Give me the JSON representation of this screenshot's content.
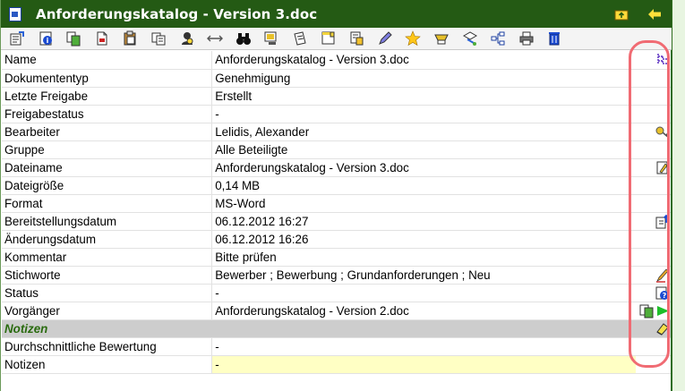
{
  "window": {
    "title": "Anforderungskatalog - Version 3.doc",
    "title_icon": "word-doc-icon",
    "buttons": [
      "folder-up-icon",
      "back-arrow-icon"
    ]
  },
  "toolbar": {
    "icons": [
      "properties-icon",
      "info-icon",
      "copy-icon",
      "new-doc-icon",
      "paste-icon",
      "duplicate-icon",
      "user-icon",
      "move-arrows-icon",
      "binoculars-icon",
      "monitor-icon",
      "notepad-icon",
      "sticky-note-icon",
      "stamp-icon",
      "pen-icon",
      "star-icon",
      "inbox-icon",
      "workflow-icon",
      "hierarchy-icon",
      "print-icon",
      "trash-icon"
    ]
  },
  "rows": [
    {
      "label": "Name",
      "value": "Anforderungskatalog - Version 3.doc",
      "icons": [
        "tree-icon"
      ]
    },
    {
      "label": "Dokumententyp",
      "value": "Genehmigung",
      "icons": []
    },
    {
      "label": "Letzte Freigabe",
      "value": "Erstellt",
      "icons": []
    },
    {
      "label": "Freigabestatus",
      "value": "-",
      "icons": []
    },
    {
      "label": "Bearbeiter",
      "value": "Lelidis, Alexander",
      "icons": [
        "key-icon"
      ]
    },
    {
      "label": "Gruppe",
      "value": "Alle Beteiligte",
      "icons": []
    },
    {
      "label": "Dateiname",
      "value": "Anforderungskatalog - Version 3.doc",
      "icons": [
        "edit-doc-icon"
      ]
    },
    {
      "label": "Dateigröße",
      "value": "0,14 MB",
      "icons": []
    },
    {
      "label": "Format",
      "value": "MS-Word",
      "icons": []
    },
    {
      "label": "Bereitstellungsdatum",
      "value": "06.12.2012 16:27",
      "icons": [
        "upload-doc-icon"
      ]
    },
    {
      "label": "Änderungsdatum",
      "value": "06.12.2012 16:26",
      "icons": []
    },
    {
      "label": "Kommentar",
      "value": "Bitte prüfen",
      "icons": []
    },
    {
      "label": "Stichworte",
      "value": "Bewerber ; Bewerbung ; Grundanforderungen ; Neu",
      "icons": [
        "pencil-icon"
      ]
    },
    {
      "label": "Status",
      "value": "-",
      "icons": [
        "help-doc-icon"
      ]
    },
    {
      "label": "Vorgänger",
      "value": "Anforderungskatalog - Version 2.doc",
      "icons": [
        "copy-doc-icon",
        "play-icon"
      ]
    }
  ],
  "notes_section": {
    "label": "Notizen",
    "icon": "eraser-icon"
  },
  "rows_after": [
    {
      "label": "Durchschnittliche Bewertung",
      "value": "-"
    },
    {
      "label": "Notizen",
      "value": "-"
    }
  ],
  "colors": {
    "titlebar": "#245a14",
    "section_text": "#2a6b0f",
    "callout": "#f06b73",
    "notes_field": "#ffffc4"
  }
}
